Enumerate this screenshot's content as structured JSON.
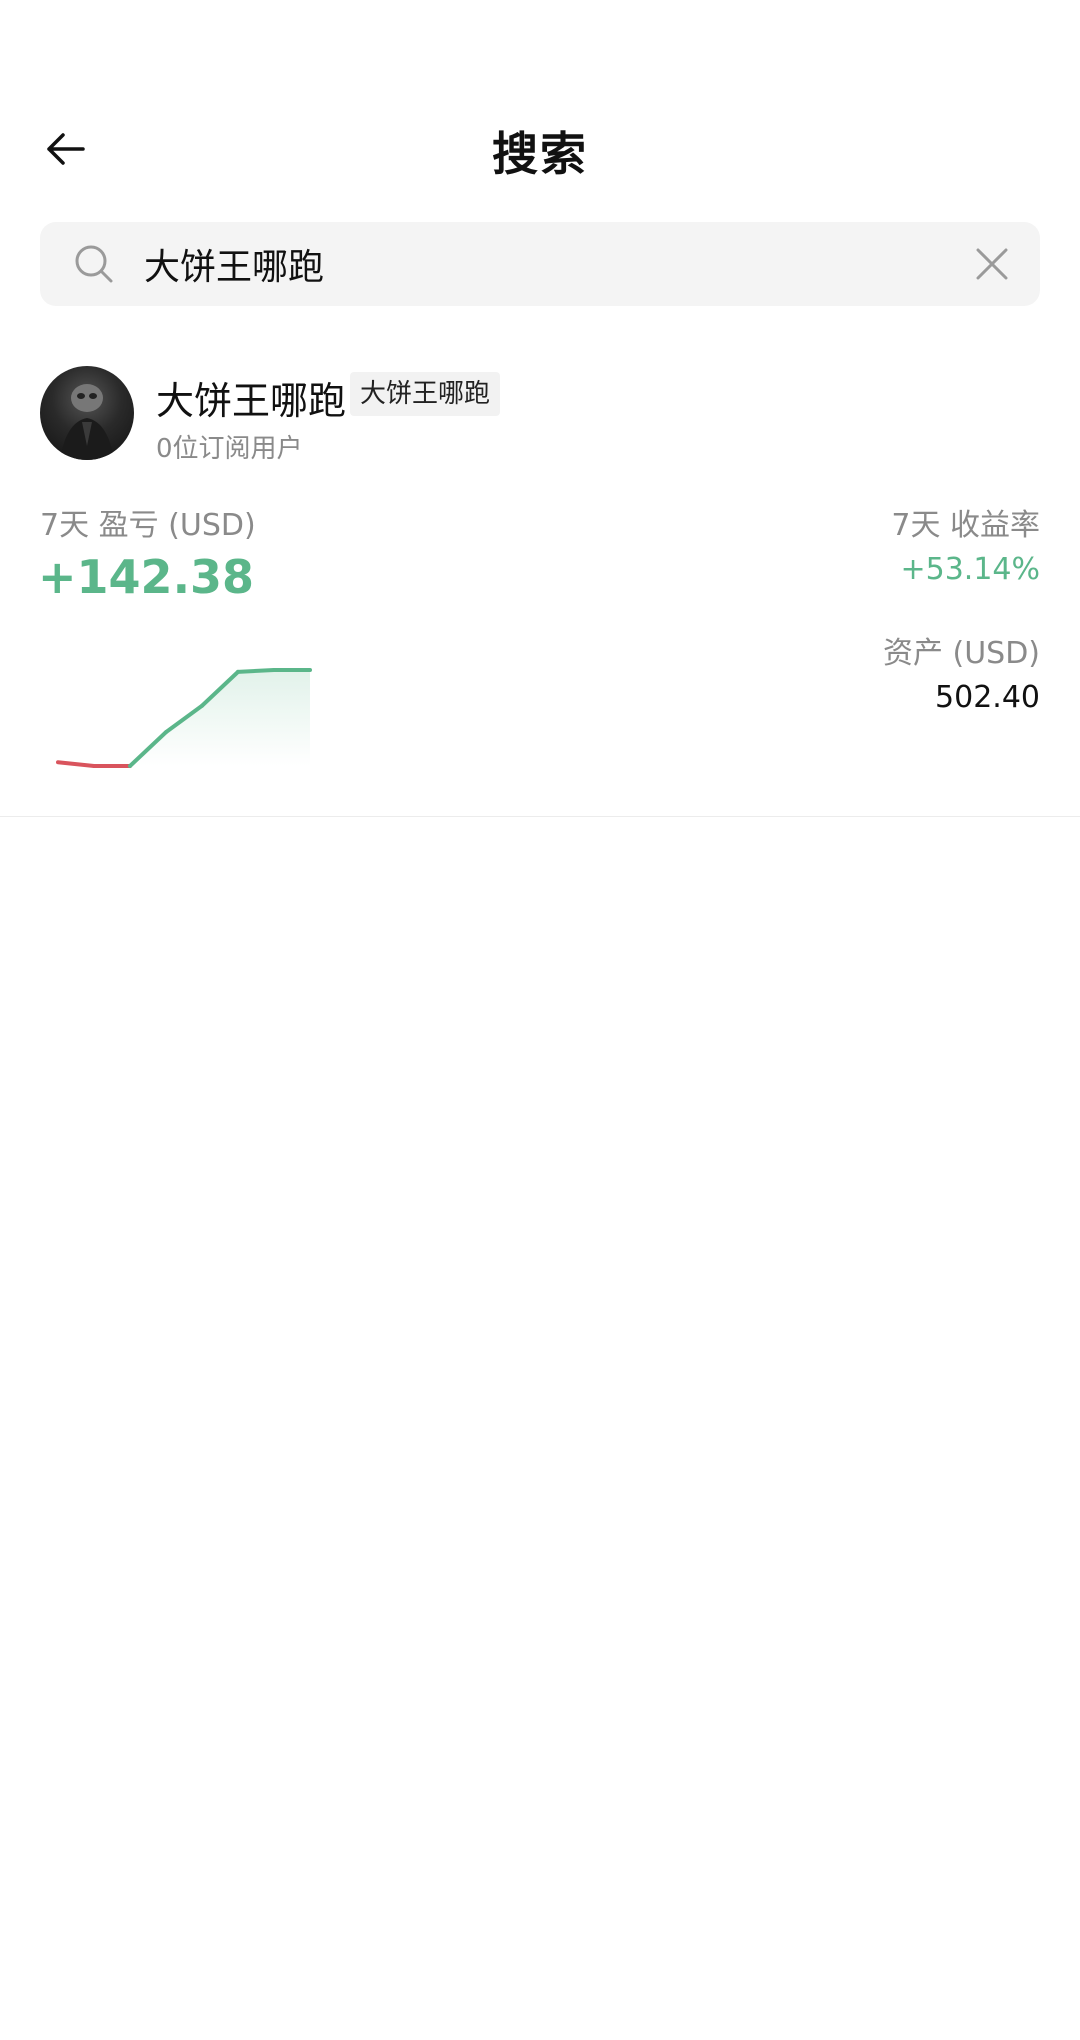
{
  "header": {
    "title": "搜索",
    "back_icon": "arrow-left-icon"
  },
  "search": {
    "query": "大饼王哪跑",
    "placeholder": "",
    "search_icon": "search-icon",
    "clear_icon": "close-icon"
  },
  "results": [
    {
      "name": "大饼王哪跑",
      "tag": "大饼王哪跑",
      "subscribers": "0位订阅用户",
      "pnl_label": "7天 盈亏 (USD)",
      "pnl_value": "+142.38",
      "roi_label": "7天 收益率",
      "roi_value": "+53.14%",
      "assets_label": "资产 (USD)",
      "assets_value": "502.40",
      "sparkline": {
        "values": [
          -8,
          -10,
          -10,
          8,
          22,
          40,
          41,
          41
        ],
        "up_color": "#5bb68a",
        "down_color": "#d9545d"
      }
    }
  ]
}
